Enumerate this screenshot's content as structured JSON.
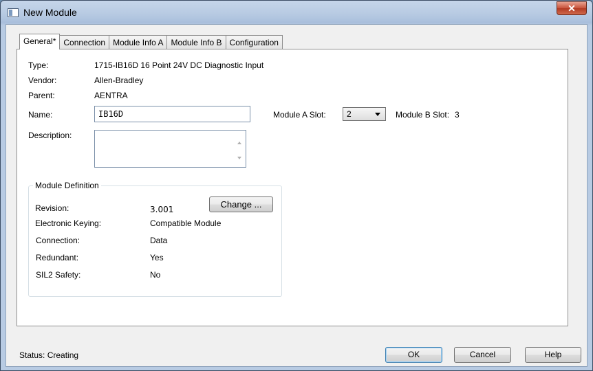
{
  "window": {
    "title": "New Module"
  },
  "tabs": [
    "General*",
    "Connection",
    "Module Info A",
    "Module Info B",
    "Configuration"
  ],
  "general": {
    "type_label": "Type:",
    "type_value": "1715-IB16D 16 Point 24V DC Diagnostic Input",
    "vendor_label": "Vendor:",
    "vendor_value": "Allen-Bradley",
    "parent_label": "Parent:",
    "parent_value": "AENTRA",
    "name_label": "Name:",
    "name_value": "IB16D",
    "description_label": "Description:",
    "description_value": "",
    "module_a_slot_label": "Module A Slot:",
    "module_a_slot_value": "2",
    "module_b_slot_label": "Module B Slot:",
    "module_b_slot_value": "3"
  },
  "module_definition": {
    "title": "Module Definition",
    "revision_label": "Revision:",
    "revision_value": "3.001",
    "change_button": "Change ...",
    "keying_label": "Electronic Keying:",
    "keying_value": "Compatible Module",
    "connection_label": "Connection:",
    "connection_value": "Data",
    "redundant_label": "Redundant:",
    "redundant_value": "Yes",
    "sil2_label": "SIL2 Safety:",
    "sil2_value": "No"
  },
  "footer": {
    "status_label": "Status:",
    "status_value": "Creating",
    "ok": "OK",
    "cancel": "Cancel",
    "help": "Help"
  }
}
